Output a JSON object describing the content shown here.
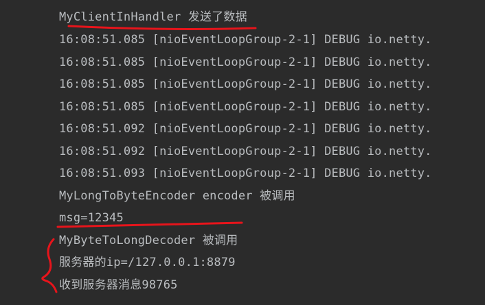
{
  "console": {
    "lines": [
      "MyClientInHandler 发送了数据",
      "16:08:51.085 [nioEventLoopGroup-2-1] DEBUG io.netty.",
      "16:08:51.085 [nioEventLoopGroup-2-1] DEBUG io.netty.",
      "16:08:51.085 [nioEventLoopGroup-2-1] DEBUG io.netty.",
      "16:08:51.085 [nioEventLoopGroup-2-1] DEBUG io.netty.",
      "16:08:51.092 [nioEventLoopGroup-2-1] DEBUG io.netty.",
      "16:08:51.092 [nioEventLoopGroup-2-1] DEBUG io.netty.",
      "16:08:51.093 [nioEventLoopGroup-2-1] DEBUG io.netty.",
      "MyLongToByteEncoder encoder 被调用",
      "msg=12345",
      "MyByteToLongDecoder 被调用",
      "服务器的ip=/127.0.0.1:8879",
      "收到服务器消息98765"
    ]
  },
  "colors": {
    "background": "#2b2b2b",
    "text": "#b9bcbf",
    "annotation": "#e8141b"
  }
}
